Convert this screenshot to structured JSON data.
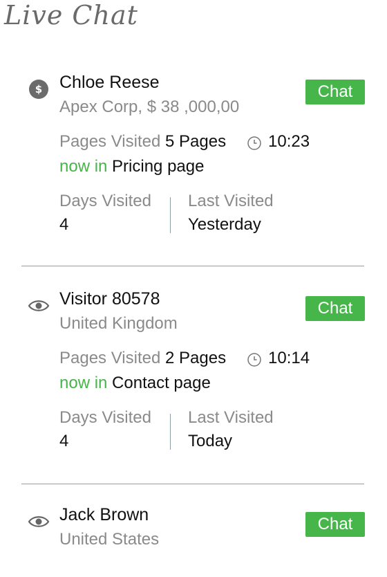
{
  "header": {
    "title": "Live Chat"
  },
  "visitors": [
    {
      "icon": "dollar-icon",
      "name": "Chloe Reese",
      "subtitle": "Apex Corp, $ 38 ,000,00",
      "chat_label": "Chat",
      "pages_label": "Pages Visited",
      "pages_value": "5 Pages",
      "time": "10:23",
      "now_in_label": "now in",
      "now_in_page": "Pricing page",
      "days_label": "Days Visited",
      "days_value": "4",
      "last_label": "Last Visited",
      "last_value": "Yesterday"
    },
    {
      "icon": "eye-icon",
      "name": "Visitor 80578",
      "subtitle": "United Kingdom",
      "chat_label": "Chat",
      "pages_label": "Pages Visited",
      "pages_value": "2 Pages",
      "time": "10:14",
      "now_in_label": "now in",
      "now_in_page": "Contact page",
      "days_label": "Days Visited",
      "days_value": "4",
      "last_label": "Last Visited",
      "last_value": "Today"
    },
    {
      "icon": "eye-icon",
      "name": "Jack Brown",
      "subtitle": "United States",
      "chat_label": "Chat"
    }
  ],
  "colors": {
    "accent_green": "#46b54a",
    "muted_text": "#8a8a8a"
  }
}
